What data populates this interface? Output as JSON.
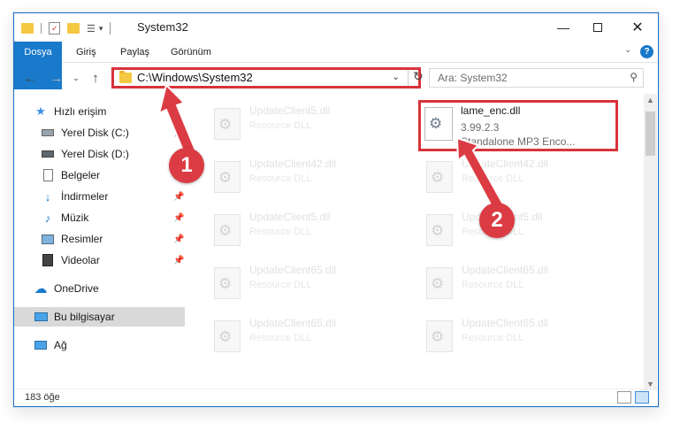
{
  "window": {
    "title": "System32"
  },
  "ribbon": {
    "tabs": [
      "Dosya",
      "Giriş",
      "Paylaş",
      "Görünüm"
    ]
  },
  "address": {
    "path": "C:\\Windows\\System32"
  },
  "search": {
    "placeholder": "Ara: System32"
  },
  "sidebar": {
    "items": [
      {
        "label": "Hızlı erişim",
        "icon": "star-icon"
      },
      {
        "label": "Yerel Disk (C:)",
        "icon": "drive-icon",
        "pinned": true
      },
      {
        "label": "Yerel Disk (D:)",
        "icon": "drive-icon",
        "pinned": true
      },
      {
        "label": "Belgeler",
        "icon": "document-icon",
        "pinned": true
      },
      {
        "label": "İndirmeler",
        "icon": "download-icon",
        "pinned": true
      },
      {
        "label": "Müzik",
        "icon": "music-icon",
        "pinned": true
      },
      {
        "label": "Resimler",
        "icon": "picture-icon",
        "pinned": true
      },
      {
        "label": "Videolar",
        "icon": "video-icon",
        "pinned": true
      },
      {
        "label": "OneDrive",
        "icon": "cloud-icon"
      },
      {
        "label": "Bu bilgisayar",
        "icon": "computer-icon",
        "selected": true
      },
      {
        "label": "Ağ",
        "icon": "network-icon"
      }
    ]
  },
  "files": {
    "highlighted": {
      "name": "lame_enc.dll",
      "version": "3.99.2.3",
      "description": "Standalone MP3 Enco..."
    },
    "faded": [
      {
        "name": "UpdateClient5.dll",
        "type": "Resource DLL"
      },
      {
        "name": "UpdateClient42.dll",
        "type": "Resource DLL"
      },
      {
        "name": "UpdateClient42.dll",
        "type": "Resource DLL"
      },
      {
        "name": "UpdateClient5.dll",
        "type": "Resource DLL"
      },
      {
        "name": "UpdateClient5.dll",
        "type": "Resource DLL"
      },
      {
        "name": "UpdateClient65.dll",
        "type": "Resource DLL"
      },
      {
        "name": "UpdateClient65.dll",
        "type": "Resource DLL"
      },
      {
        "name": "UpdateClient65.dll",
        "type": "Resource DLL"
      },
      {
        "name": "UpdateClient65.dll",
        "type": "Resource DLL"
      }
    ]
  },
  "status": {
    "count": "183 öğe"
  },
  "annotations": {
    "step1": "1",
    "step2": "2",
    "accent": "#d8333b"
  }
}
